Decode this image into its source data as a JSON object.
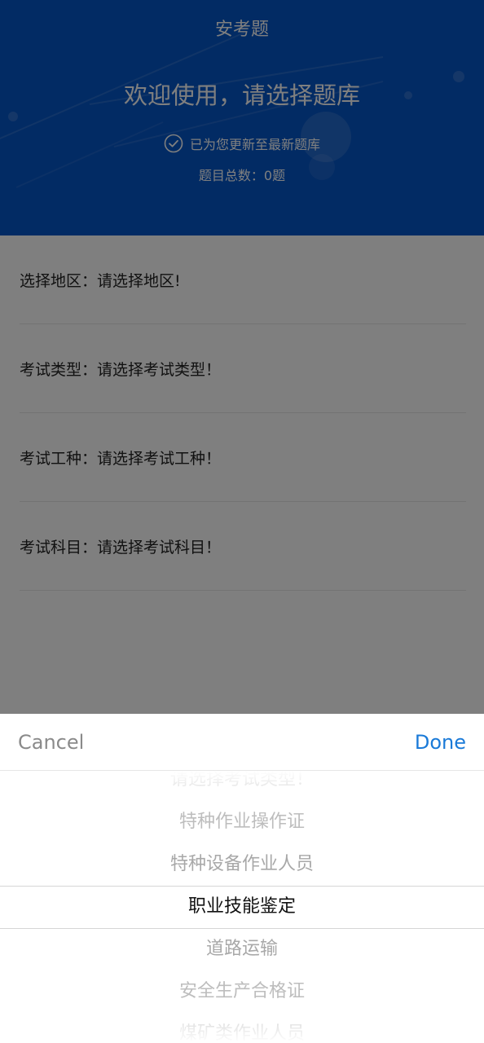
{
  "header": {
    "title": "安考题",
    "welcome": "欢迎使用，请选择题库",
    "status": "已为您更新至最新题库",
    "total": "题目总数：0题"
  },
  "form": {
    "rows": [
      {
        "label": "选择地区：",
        "value": "请选择地区!"
      },
      {
        "label": "考试类型：",
        "value": "请选择考试类型！"
      },
      {
        "label": "考试工种：",
        "value": "请选择考试工种！"
      },
      {
        "label": "考试科目：",
        "value": "请选择考试科目！"
      }
    ]
  },
  "picker": {
    "cancel_label": "Cancel",
    "done_label": "Done",
    "options": [
      "请选择考试类型！",
      "特种作业操作证",
      "特种设备作业人员",
      "职业技能鉴定",
      "道路运输",
      "安全生产合格证",
      "煤矿类作业人员"
    ],
    "selected_index": 3
  },
  "colors": {
    "header_bg": "#0556c9",
    "done": "#1a7ad8",
    "cancel": "#8a8a8a"
  }
}
